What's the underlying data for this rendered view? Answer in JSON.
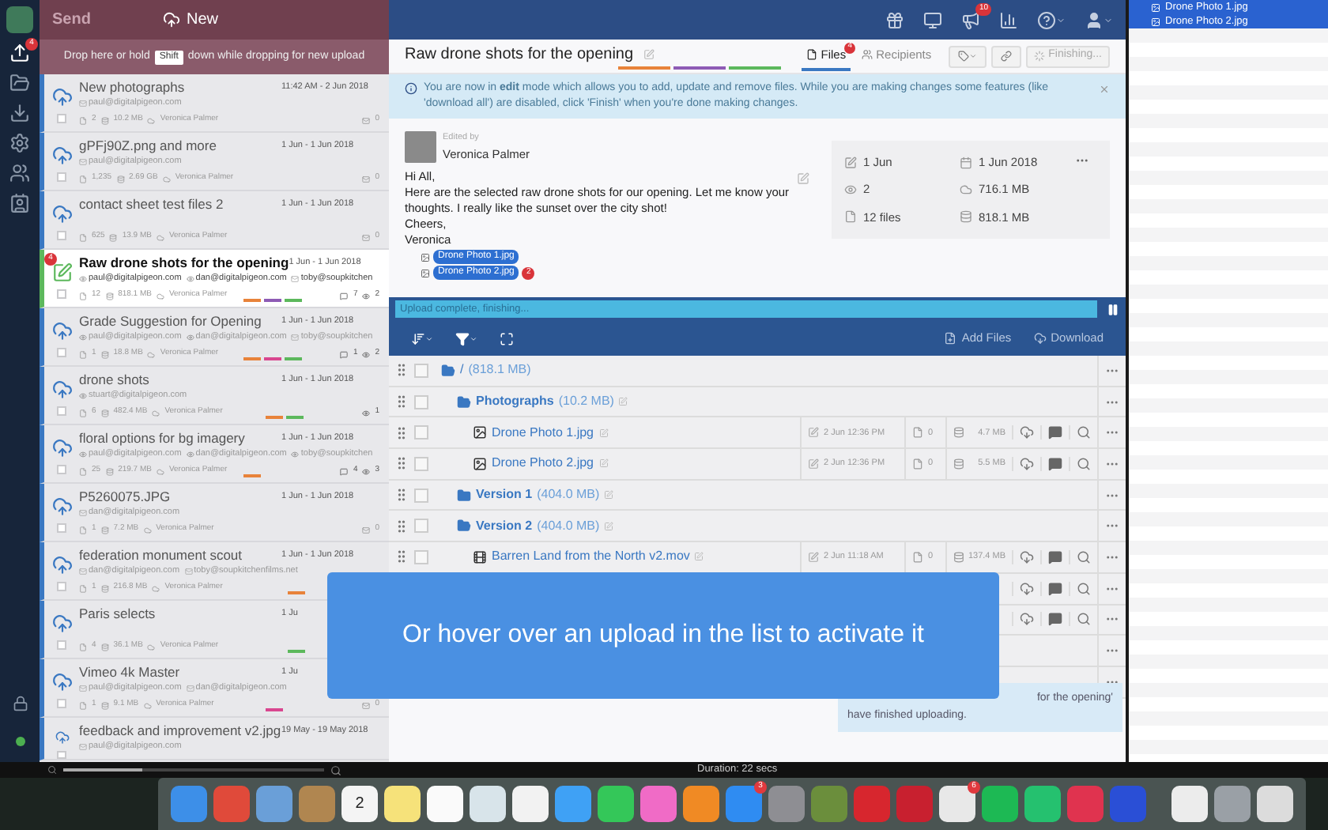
{
  "sidebar": {
    "items": [
      {
        "badge": "4",
        "selected": true
      },
      {
        "selected": false
      },
      {
        "selected": false
      },
      {
        "selected": false
      },
      {
        "selected": false
      },
      {
        "selected": false
      }
    ]
  },
  "uploads_header": {
    "send": "Send",
    "new": "New",
    "hint_before": "Drop here or hold",
    "hint_key": "Shift",
    "hint_after": "down while dropping for new upload"
  },
  "uploads": [
    {
      "name": "New photographs",
      "date": "11:42 AM - 2 Jun 2018",
      "emails": [
        {
          "address": "paul@digitalpigeon.com",
          "viewed": false
        }
      ],
      "files": "2",
      "size": "10.2 MB",
      "owner": "Veronica Palmer",
      "messages": "0",
      "selected": false,
      "checked": false
    },
    {
      "name": "gPFj90Z.png and more",
      "date": "1 Jun - 1 Jun 2018",
      "emails": [
        {
          "address": "paul@digitalpigeon.com",
          "viewed": false
        }
      ],
      "files": "1,235",
      "size": "2.69 GB",
      "owner": "Veronica Palmer",
      "messages": "0",
      "selected": false,
      "checked": false
    },
    {
      "name": "contact sheet test files 2",
      "date": "1 Jun - 1 Jun 2018",
      "files": "625",
      "size": "13.9 MB",
      "owner": "Veronica Palmer",
      "messages": "0",
      "selected": false,
      "checked": false
    },
    {
      "name": "Raw drone shots for the opening",
      "date": "1 Jun - 1 Jun 2018",
      "badge": "4",
      "emails": [
        {
          "address": "paul@digitalpigeon.com",
          "viewed": true
        },
        {
          "address": "dan@digitalpigeon.com",
          "viewed": true
        },
        {
          "address": "toby@soupkitchen",
          "viewed": false
        }
      ],
      "files": "12",
      "size": "818.1 MB",
      "owner": "Veronica Palmer",
      "comments": "7",
      "views": "2",
      "tags": [
        {
          "color": "#e8833a"
        },
        {
          "color": "#8e5bb5"
        },
        {
          "color": "#5cb85c"
        }
      ],
      "selected": true,
      "checked": false
    },
    {
      "name": "Grade Suggestion for Opening",
      "date": "1 Jun - 1 Jun 2018",
      "emails": [
        {
          "address": "paul@digitalpigeon.com",
          "viewed": true
        },
        {
          "address": "dan@digitalpigeon.com",
          "viewed": true
        },
        {
          "address": "toby@soupkitchen",
          "viewed": false
        }
      ],
      "files": "1",
      "size": "18.8 MB",
      "owner": "Veronica Palmer",
      "comments": "1",
      "views": "2",
      "tags": [
        {
          "color": "#e8833a"
        },
        {
          "color": "#d9468f"
        },
        {
          "color": "#5cb85c"
        }
      ],
      "selected": false,
      "checked": false
    },
    {
      "name": "drone shots",
      "date": "1 Jun - 1 Jun 2018",
      "emails": [
        {
          "address": "stuart@digitalpigeon.com",
          "viewed": true
        }
      ],
      "files": "6",
      "size": "482.4 MB",
      "owner": "Veronica Palmer",
      "views": "1",
      "tags": [
        {
          "color": "#e8833a"
        },
        {
          "color": "#5cb85c"
        }
      ],
      "selected": false,
      "checked": false
    },
    {
      "name": "floral options for bg imagery",
      "date": "1 Jun - 1 Jun 2018",
      "emails": [
        {
          "address": "paul@digitalpigeon.com",
          "viewed": true
        },
        {
          "address": "dan@digitalpigeon.com",
          "viewed": true
        },
        {
          "address": "toby@soupkitchen",
          "viewed": true
        }
      ],
      "files": "25",
      "size": "219.7 MB",
      "owner": "Veronica Palmer",
      "comments": "4",
      "views": "3",
      "tags": [
        {
          "color": "#e8833a"
        }
      ],
      "selected": false,
      "checked": false
    },
    {
      "name": "P5260075.JPG",
      "date": "1 Jun - 1 Jun 2018",
      "emails": [
        {
          "address": "dan@digitalpigeon.com",
          "viewed": false
        }
      ],
      "files": "1",
      "size": "7.2 MB",
      "owner": "Veronica Palmer",
      "messages": "0",
      "selected": false,
      "checked": false
    },
    {
      "name": "federation monument scout",
      "date": "1 Jun - 1 Jun 2018",
      "emails": [
        {
          "address": "dan@digitalpigeon.com",
          "viewed": false
        },
        {
          "address": "toby@soupkitchenfilms.net",
          "viewed": false
        }
      ],
      "files": "1",
      "size": "216.8 MB",
      "owner": "Veronica Palmer",
      "tags": [
        {
          "color": "#e8833a"
        }
      ],
      "selected": false,
      "checked": false
    },
    {
      "name": "Paris selects",
      "date": "1 Ju",
      "files": "4",
      "size": "36.1 MB",
      "owner": "Veronica Palmer",
      "tags": [
        {
          "color": "#5cb85c"
        }
      ],
      "selected": false,
      "checked": false
    },
    {
      "name": "Vimeo 4k Master",
      "date": "1 Ju",
      "emails": [
        {
          "address": "paul@digitalpigeon.com",
          "viewed": false
        },
        {
          "address": "dan@digitalpigeon.com",
          "viewed": false
        }
      ],
      "files": "1",
      "size": "9.1 MB",
      "owner": "Veronica Palmer",
      "messages": "0",
      "tags": [
        {
          "color": "#d9468f"
        }
      ],
      "selected": false,
      "checked": false
    },
    {
      "name": "feedback and improvement v2.jpg",
      "date": "19 May - 19 May 2018",
      "emails": [
        {
          "address": "paul@digitalpigeon.com",
          "viewed": false
        }
      ],
      "selected": false,
      "checked": false
    }
  ],
  "navbar": {
    "notifications": "10"
  },
  "upload": {
    "title": "Raw drone shots for the opening",
    "tags": [
      {
        "color": "#e8833a"
      },
      {
        "color": "#8e5bb5"
      },
      {
        "color": "#5cb85c"
      }
    ],
    "tabs": [
      {
        "label": "Files",
        "badge": "4",
        "selected": true
      },
      {
        "label": "Recipients",
        "selected": false
      }
    ],
    "finish_button": {
      "label": "Finishing...",
      "disabled": true
    }
  },
  "banner": {
    "text": "You are now in **edit** mode which allows you to add, update and remove files. While you are making changes some features (like 'download all') are disabled, click 'Finish' when you're done making changes."
  },
  "message": {
    "edited_by": "Edited by",
    "author": "Veronica Palmer",
    "lines": [
      "Hi All,",
      "Here are the selected raw drone shots for our opening. Let me know your thoughts. I really like the sunset over the city shot!",
      "Cheers,",
      "Veronica"
    ]
  },
  "stats": [
    "1 Jun",
    "1 Jun 2018",
    "2",
    "716.1 MB",
    "12 files",
    "818.1 MB"
  ],
  "drag": {
    "items": [
      "Drone Photo 1.jpg",
      "Drone Photo 2.jpg"
    ],
    "count": "2"
  },
  "progress": {
    "label": "Upload complete, finishing...",
    "level": 1
  },
  "toolbar": {
    "add_files": "Add Files",
    "download": "Download"
  },
  "files": [
    {
      "kind": "folder",
      "name": "/",
      "size": "(818.1 MB)",
      "expanded": true,
      "checked": false,
      "children": [
        {
          "kind": "folder",
          "name": "Photographs",
          "size": "(10.2 MB)",
          "expanded": true,
          "checked": false,
          "children": [
            {
              "kind": "image",
              "name": "Drone Photo 1.jpg",
              "modified": "2 Jun 12:36 PM",
              "comments": "0",
              "size": "4.7 MB",
              "checked": false
            },
            {
              "kind": "image",
              "name": "Drone Photo 2.jpg",
              "modified": "2 Jun 12:36 PM",
              "comments": "0",
              "size": "5.5 MB",
              "checked": false
            }
          ]
        },
        {
          "kind": "folder",
          "name": "Version 1",
          "size": "(404.0 MB)",
          "expanded": false,
          "checked": false
        },
        {
          "kind": "folder",
          "name": "Version 2",
          "size": "(404.0 MB)",
          "expanded": true,
          "checked": false,
          "children": [
            {
              "kind": "video",
              "name": "Barren Land from the North v2.mov",
              "modified": "2 Jun 11:18 AM",
              "comments": "0",
              "size": "137.4 MB",
              "checked": false
            }
          ]
        }
      ]
    }
  ],
  "overlay": {
    "text": "Or hover over an upload in the list to activate it"
  },
  "toast": {
    "lines": [
      "for the opening'",
      "have finished uploading."
    ]
  },
  "finder": {
    "items": [
      {
        "name": "Drone Photo 1.jpg",
        "selected": true
      },
      {
        "name": "Drone Photo 2.jpg",
        "selected": true
      }
    ]
  },
  "footer": {
    "duration": "Duration: 22 secs",
    "zoom": {
      "level": 0.3
    }
  },
  "dock": [
    {
      "color": "#3d8fe8"
    },
    {
      "color": "#e04a3a"
    },
    {
      "color": "#6a9fd8"
    },
    {
      "color": "#b08650"
    },
    {
      "color": "#f4f4f4",
      "text": "2"
    },
    {
      "color": "#f6e27a"
    },
    {
      "color": "#fafafa"
    },
    {
      "color": "#d8e4ea"
    },
    {
      "color": "#f2f2f2"
    },
    {
      "color": "#3fa1f5"
    },
    {
      "color": "#34c759"
    },
    {
      "color": "#f06bc6"
    },
    {
      "color": "#f08a24"
    },
    {
      "color": "#2f8cf2",
      "badge": "3"
    },
    {
      "color": "#8e8e93"
    },
    {
      "color": "#6b8e3c"
    },
    {
      "color": "#d7262e"
    },
    {
      "color": "#c8202f"
    },
    {
      "color": "#e8e8e8",
      "badge": "6"
    },
    {
      "color": "#1db954"
    },
    {
      "color": "#25c16f"
    },
    {
      "color": "#e0334f"
    },
    {
      "color": "#2a4fd6"
    },
    {
      "color": "#ececec"
    },
    {
      "color": "#9aa0a6"
    },
    {
      "color": "#dcdcdc"
    }
  ]
}
